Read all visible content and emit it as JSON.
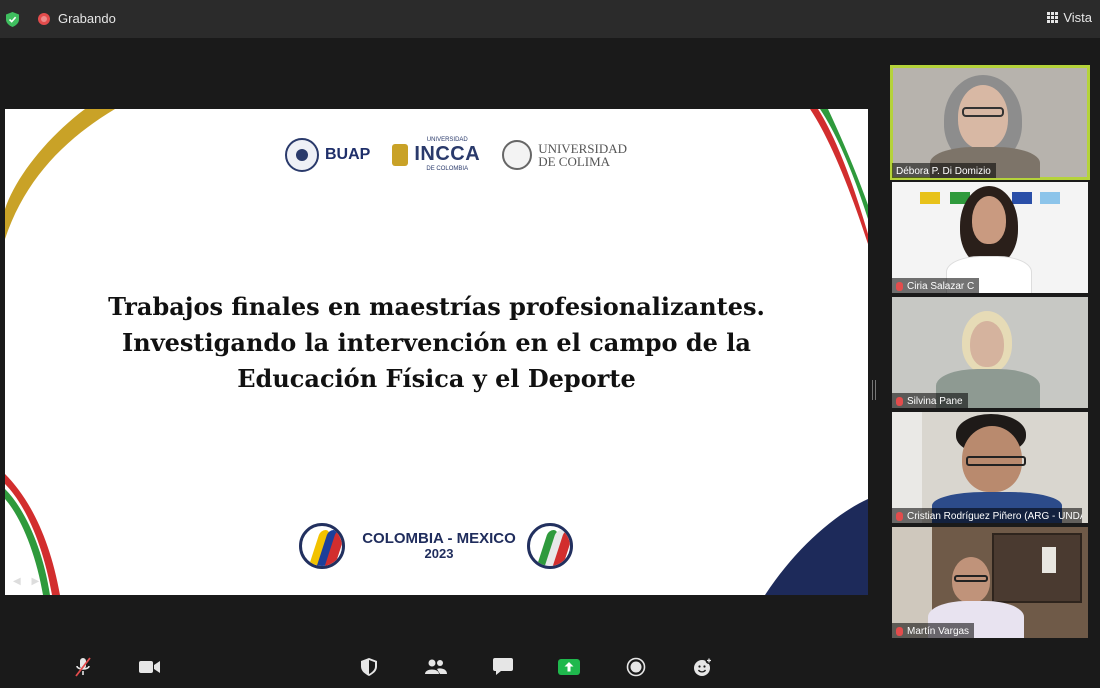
{
  "topbar": {
    "recording_label": "Grabando",
    "view_label": "Vista",
    "security_color": "#3fbf5f",
    "recording_color": "#e34c4c"
  },
  "slide": {
    "logos": {
      "buap": "BUAP",
      "incca": "INCCA",
      "incca_top": "UNIVERSIDAD",
      "incca_bottom": "DE COLOMBIA",
      "colima_line1": "UNIVERSIDAD",
      "colima_line2": "DE COLIMA"
    },
    "title_lines": [
      "Trabajos finales en maestrías profesionalizantes.",
      "Investigando la intervención en el campo de la",
      "Educación Física y el Deporte"
    ],
    "footer_event": "COLOMBIA - MEXICO",
    "footer_year": "2023"
  },
  "participants": [
    {
      "name": "Débora P. Di Domizio",
      "active_speaker": true,
      "muted": false
    },
    {
      "name": "Ciria Salazar C",
      "active_speaker": false,
      "muted": true
    },
    {
      "name": "Silvina Pane",
      "active_speaker": false,
      "muted": true
    },
    {
      "name": "Cristian Rodríguez Piñero (ARG - UNDA...",
      "active_speaker": false,
      "muted": true
    },
    {
      "name": "Martín Vargas",
      "active_speaker": false,
      "muted": true
    }
  ],
  "toolbar": {
    "buttons": [
      "mute-icon",
      "video-icon",
      "security-icon",
      "participants-icon",
      "chat-icon",
      "share-screen-icon",
      "record-icon",
      "reactions-icon"
    ],
    "share_color": "#1fb84d"
  }
}
